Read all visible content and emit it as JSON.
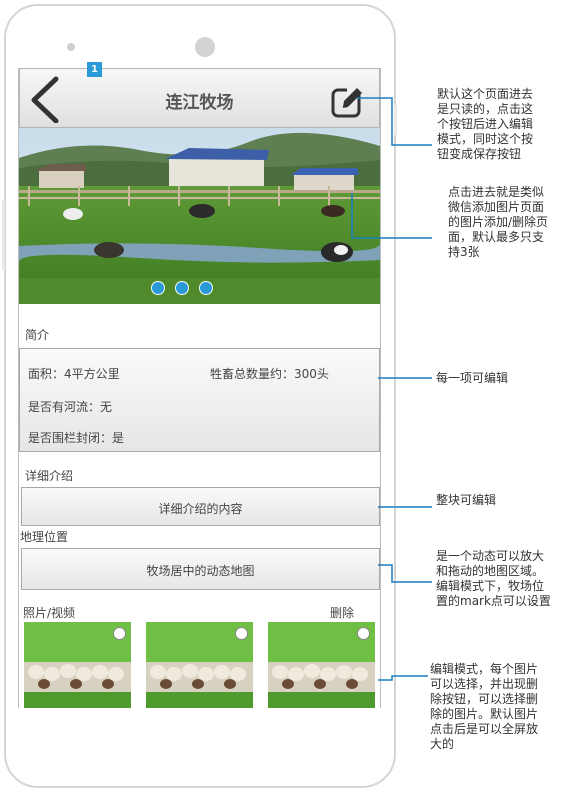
{
  "header": {
    "title": "连江牧场",
    "badge": "1"
  },
  "carousel": {
    "page_count": 3,
    "current_page": 1
  },
  "intro": {
    "label": "简介",
    "area": "面积：4平方公里",
    "livestock": "牲畜总数量约：300头",
    "river": "是否有河流：无",
    "fence": "是否围栏封闭：是"
  },
  "detail": {
    "label": "详细介绍",
    "content": "详细介绍的内容"
  },
  "location": {
    "label": "地理位置",
    "map_text": "牧场居中的动态地图"
  },
  "media": {
    "label": "照片/视频",
    "delete_label": "删除",
    "thumbnails": [
      "sheep-photo",
      "sheep-photo",
      "sheep-photo"
    ]
  },
  "annotations": {
    "edit_note": [
      "默认这个页面进去",
      "是只读的，点击这",
      "个按钮后进入编辑",
      "模式，同时这个按",
      "钮变成保存按钮"
    ],
    "carousel_note": [
      "点击进去就是类似",
      "微信添加图片页面",
      "的图片添加/删除页",
      "面，默认最多只支",
      "持3张"
    ],
    "intro_note": "每一项可编辑",
    "detail_note": "整块可编辑",
    "map_note": [
      "是一个动态可以放大",
      "和拖动的地图区域。",
      "编辑模式下，牧场位",
      "置的mark点可以设置"
    ],
    "media_note": [
      "编辑模式，每个图片",
      "可以选择，并出现删",
      "除按钮，可以选择删",
      "除的图片。默认图片",
      "点击后是可以全屏放",
      "大的"
    ]
  },
  "colors": {
    "accent": "#2b98d6",
    "annotation_line": "#1a7fc0"
  }
}
